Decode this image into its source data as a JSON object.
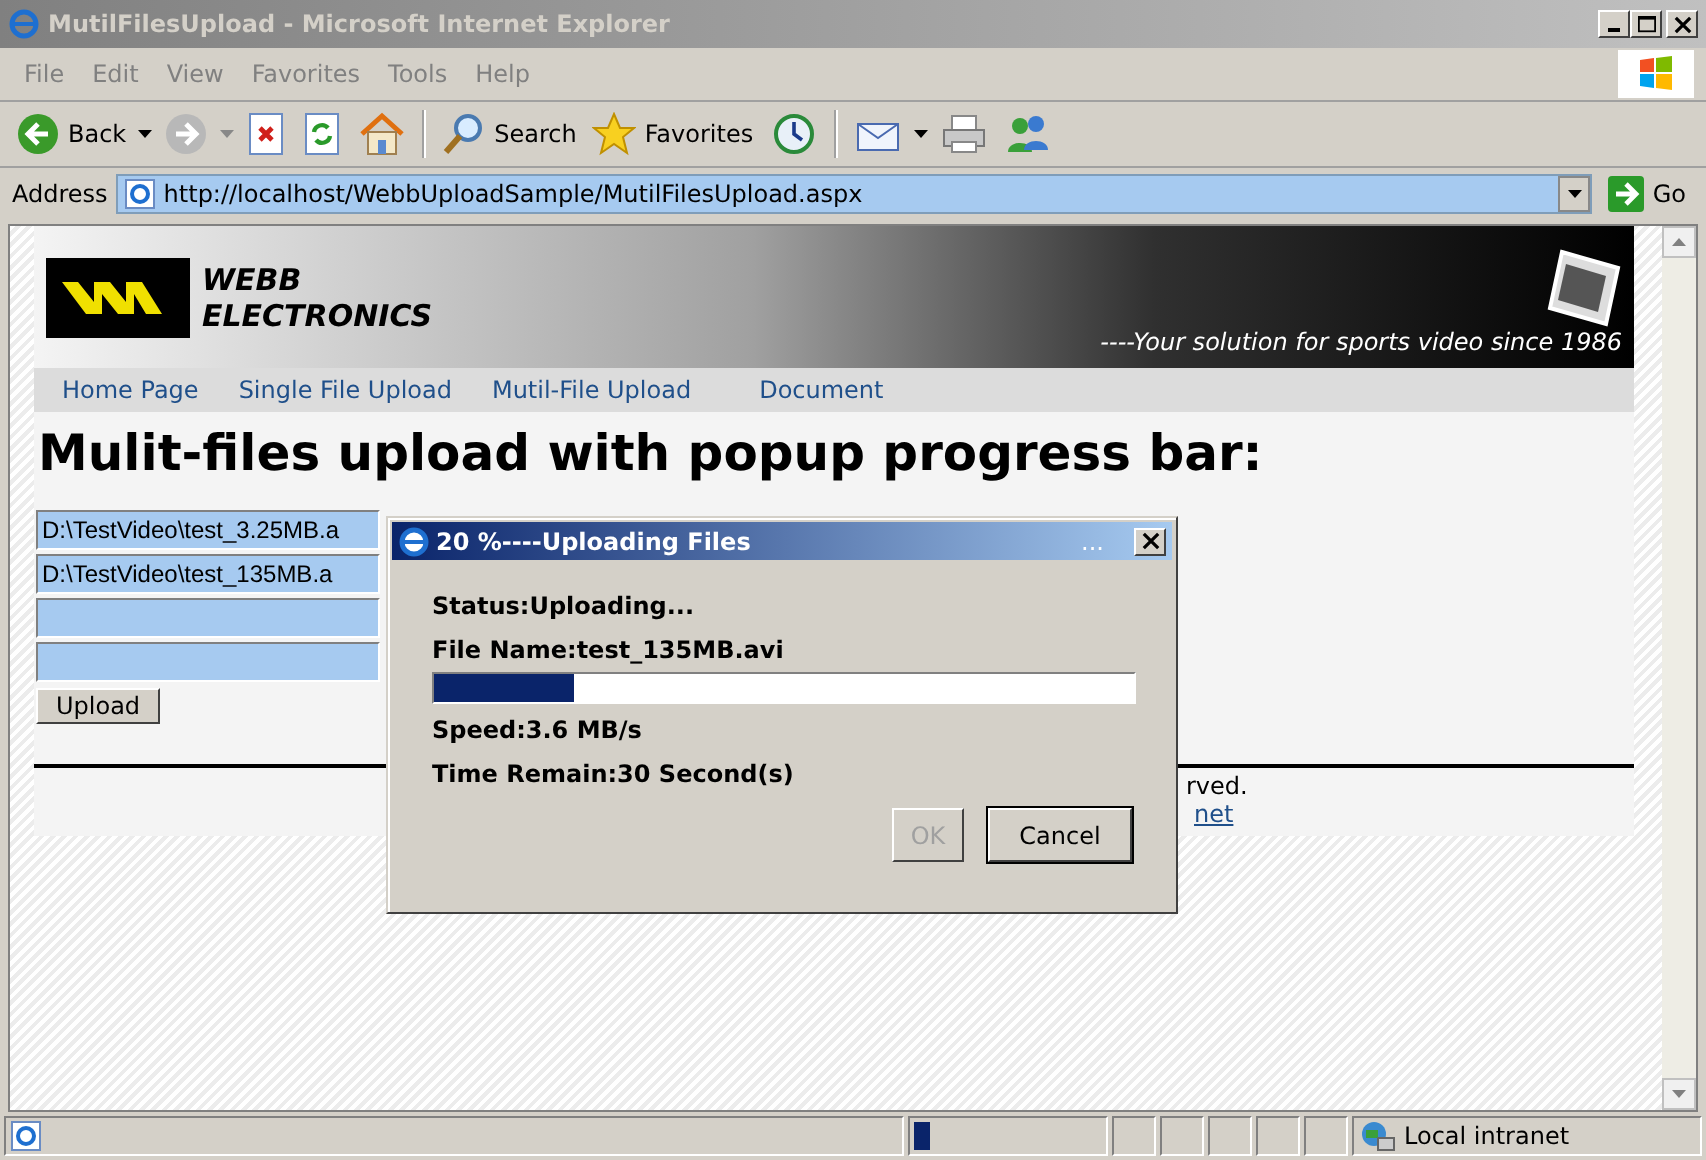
{
  "window": {
    "title": "MutilFilesUpload - Microsoft Internet Explorer"
  },
  "menu": [
    "File",
    "Edit",
    "View",
    "Favorites",
    "Tools",
    "Help"
  ],
  "toolbar": {
    "back": "Back",
    "search": "Search",
    "favorites": "Favorites"
  },
  "address": {
    "label": "Address",
    "url": "http://localhost/WebbUploadSample/MutilFilesUpload.aspx",
    "go": "Go"
  },
  "page": {
    "logo_line1": "WEBB",
    "logo_line2": "ELECTRONICS",
    "tagline": "----Your solution for sports video since 1986",
    "nav": [
      "Home Page",
      "Single File Upload",
      "Mutil-File Upload",
      "Document"
    ],
    "heading": "Mulit-files upload with popup progress bar:",
    "files": [
      {
        "kind": "file",
        "value": "D:\\TestVideo\\test_3.25MB.a"
      },
      {
        "kind": "file",
        "value": "D:\\TestVideo\\test_135MB.a"
      },
      {
        "kind": "file"
      },
      {
        "kind": "file"
      }
    ],
    "upload_button": "Upload",
    "footer_text": "rved.",
    "footer_link": "net"
  },
  "dialog": {
    "title": "20 %----Uploading Files",
    "title_dots": "...",
    "status": "Status:Uploading...",
    "file_name": "File Name:test_135MB.avi",
    "level": 0.2,
    "speed": "Speed:3.6 MB/s",
    "time_remain": "Time Remain:30 Second(s)",
    "ok": {
      "label": "OK",
      "disabled": true
    },
    "cancel": {
      "label": "Cancel",
      "disabled": false
    }
  },
  "status_bar": {
    "progress": {
      "level": 0.08
    },
    "zone": "Local intranet"
  }
}
